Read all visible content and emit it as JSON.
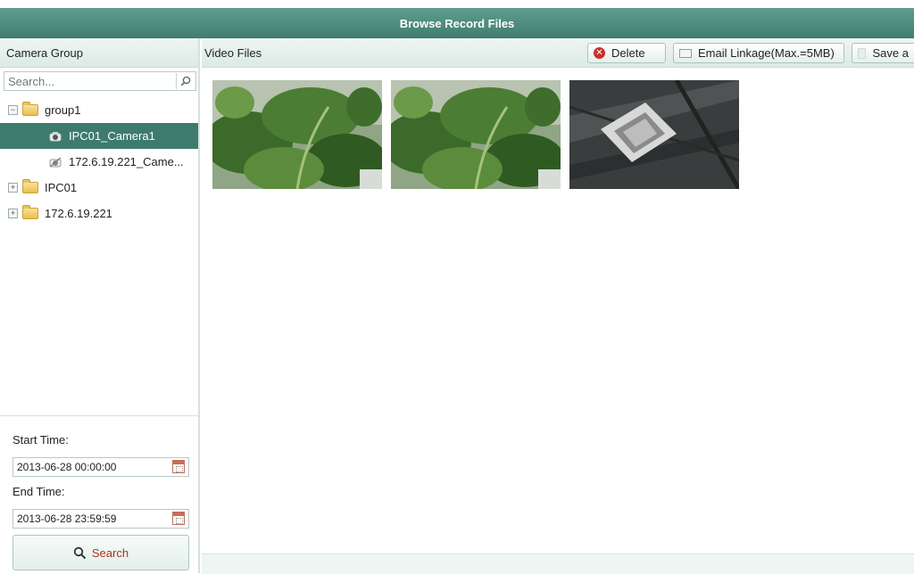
{
  "window": {
    "title": "Browse Record Files"
  },
  "left_panel": {
    "header": "Camera Group",
    "search_placeholder": "Search...",
    "tree": [
      {
        "label": "group1",
        "expander": "−"
      },
      {
        "label": "IPC01_Camera1",
        "selected": true
      },
      {
        "label": "172.6.19.221_Came..."
      },
      {
        "label": "IPC01",
        "expander": "+"
      },
      {
        "label": "172.6.19.221",
        "expander": "+"
      }
    ],
    "start_time_label": "Start Time:",
    "start_time_value": "2013-06-28 00:00:00",
    "end_time_label": "End Time:",
    "end_time_value": "2013-06-28 23:59:59",
    "search_button": "Search"
  },
  "right_panel": {
    "header": "Video Files",
    "delete_label": "Delete",
    "email_label": "Email Linkage(Max.=5MB)",
    "save_label": "Save a",
    "thumbnails": [
      {
        "scene": "plant"
      },
      {
        "scene": "plant"
      },
      {
        "scene": "ceiling"
      }
    ]
  },
  "colors": {
    "titlebar": "#4a8a7a",
    "selected_row": "#3d7b6d",
    "search_text": "#b0322a"
  }
}
